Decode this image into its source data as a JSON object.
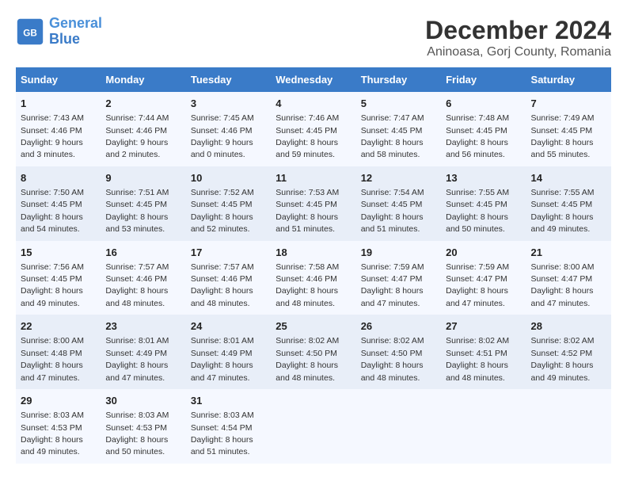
{
  "header": {
    "logo_line1": "General",
    "logo_line2": "Blue",
    "title": "December 2024",
    "subtitle": "Aninoasa, Gorj County, Romania"
  },
  "days_of_week": [
    "Sunday",
    "Monday",
    "Tuesday",
    "Wednesday",
    "Thursday",
    "Friday",
    "Saturday"
  ],
  "weeks": [
    [
      {
        "day": "1",
        "sunrise": "7:43 AM",
        "sunset": "4:46 PM",
        "daylight": "9 hours and 3 minutes."
      },
      {
        "day": "2",
        "sunrise": "7:44 AM",
        "sunset": "4:46 PM",
        "daylight": "9 hours and 2 minutes."
      },
      {
        "day": "3",
        "sunrise": "7:45 AM",
        "sunset": "4:46 PM",
        "daylight": "9 hours and 0 minutes."
      },
      {
        "day": "4",
        "sunrise": "7:46 AM",
        "sunset": "4:45 PM",
        "daylight": "8 hours and 59 minutes."
      },
      {
        "day": "5",
        "sunrise": "7:47 AM",
        "sunset": "4:45 PM",
        "daylight": "8 hours and 58 minutes."
      },
      {
        "day": "6",
        "sunrise": "7:48 AM",
        "sunset": "4:45 PM",
        "daylight": "8 hours and 56 minutes."
      },
      {
        "day": "7",
        "sunrise": "7:49 AM",
        "sunset": "4:45 PM",
        "daylight": "8 hours and 55 minutes."
      }
    ],
    [
      {
        "day": "8",
        "sunrise": "7:50 AM",
        "sunset": "4:45 PM",
        "daylight": "8 hours and 54 minutes."
      },
      {
        "day": "9",
        "sunrise": "7:51 AM",
        "sunset": "4:45 PM",
        "daylight": "8 hours and 53 minutes."
      },
      {
        "day": "10",
        "sunrise": "7:52 AM",
        "sunset": "4:45 PM",
        "daylight": "8 hours and 52 minutes."
      },
      {
        "day": "11",
        "sunrise": "7:53 AM",
        "sunset": "4:45 PM",
        "daylight": "8 hours and 51 minutes."
      },
      {
        "day": "12",
        "sunrise": "7:54 AM",
        "sunset": "4:45 PM",
        "daylight": "8 hours and 51 minutes."
      },
      {
        "day": "13",
        "sunrise": "7:55 AM",
        "sunset": "4:45 PM",
        "daylight": "8 hours and 50 minutes."
      },
      {
        "day": "14",
        "sunrise": "7:55 AM",
        "sunset": "4:45 PM",
        "daylight": "8 hours and 49 minutes."
      }
    ],
    [
      {
        "day": "15",
        "sunrise": "7:56 AM",
        "sunset": "4:45 PM",
        "daylight": "8 hours and 49 minutes."
      },
      {
        "day": "16",
        "sunrise": "7:57 AM",
        "sunset": "4:46 PM",
        "daylight": "8 hours and 48 minutes."
      },
      {
        "day": "17",
        "sunrise": "7:57 AM",
        "sunset": "4:46 PM",
        "daylight": "8 hours and 48 minutes."
      },
      {
        "day": "18",
        "sunrise": "7:58 AM",
        "sunset": "4:46 PM",
        "daylight": "8 hours and 48 minutes."
      },
      {
        "day": "19",
        "sunrise": "7:59 AM",
        "sunset": "4:47 PM",
        "daylight": "8 hours and 47 minutes."
      },
      {
        "day": "20",
        "sunrise": "7:59 AM",
        "sunset": "4:47 PM",
        "daylight": "8 hours and 47 minutes."
      },
      {
        "day": "21",
        "sunrise": "8:00 AM",
        "sunset": "4:47 PM",
        "daylight": "8 hours and 47 minutes."
      }
    ],
    [
      {
        "day": "22",
        "sunrise": "8:00 AM",
        "sunset": "4:48 PM",
        "daylight": "8 hours and 47 minutes."
      },
      {
        "day": "23",
        "sunrise": "8:01 AM",
        "sunset": "4:49 PM",
        "daylight": "8 hours and 47 minutes."
      },
      {
        "day": "24",
        "sunrise": "8:01 AM",
        "sunset": "4:49 PM",
        "daylight": "8 hours and 47 minutes."
      },
      {
        "day": "25",
        "sunrise": "8:02 AM",
        "sunset": "4:50 PM",
        "daylight": "8 hours and 48 minutes."
      },
      {
        "day": "26",
        "sunrise": "8:02 AM",
        "sunset": "4:50 PM",
        "daylight": "8 hours and 48 minutes."
      },
      {
        "day": "27",
        "sunrise": "8:02 AM",
        "sunset": "4:51 PM",
        "daylight": "8 hours and 48 minutes."
      },
      {
        "day": "28",
        "sunrise": "8:02 AM",
        "sunset": "4:52 PM",
        "daylight": "8 hours and 49 minutes."
      }
    ],
    [
      {
        "day": "29",
        "sunrise": "8:03 AM",
        "sunset": "4:53 PM",
        "daylight": "8 hours and 49 minutes."
      },
      {
        "day": "30",
        "sunrise": "8:03 AM",
        "sunset": "4:53 PM",
        "daylight": "8 hours and 50 minutes."
      },
      {
        "day": "31",
        "sunrise": "8:03 AM",
        "sunset": "4:54 PM",
        "daylight": "8 hours and 51 minutes."
      },
      null,
      null,
      null,
      null
    ]
  ]
}
